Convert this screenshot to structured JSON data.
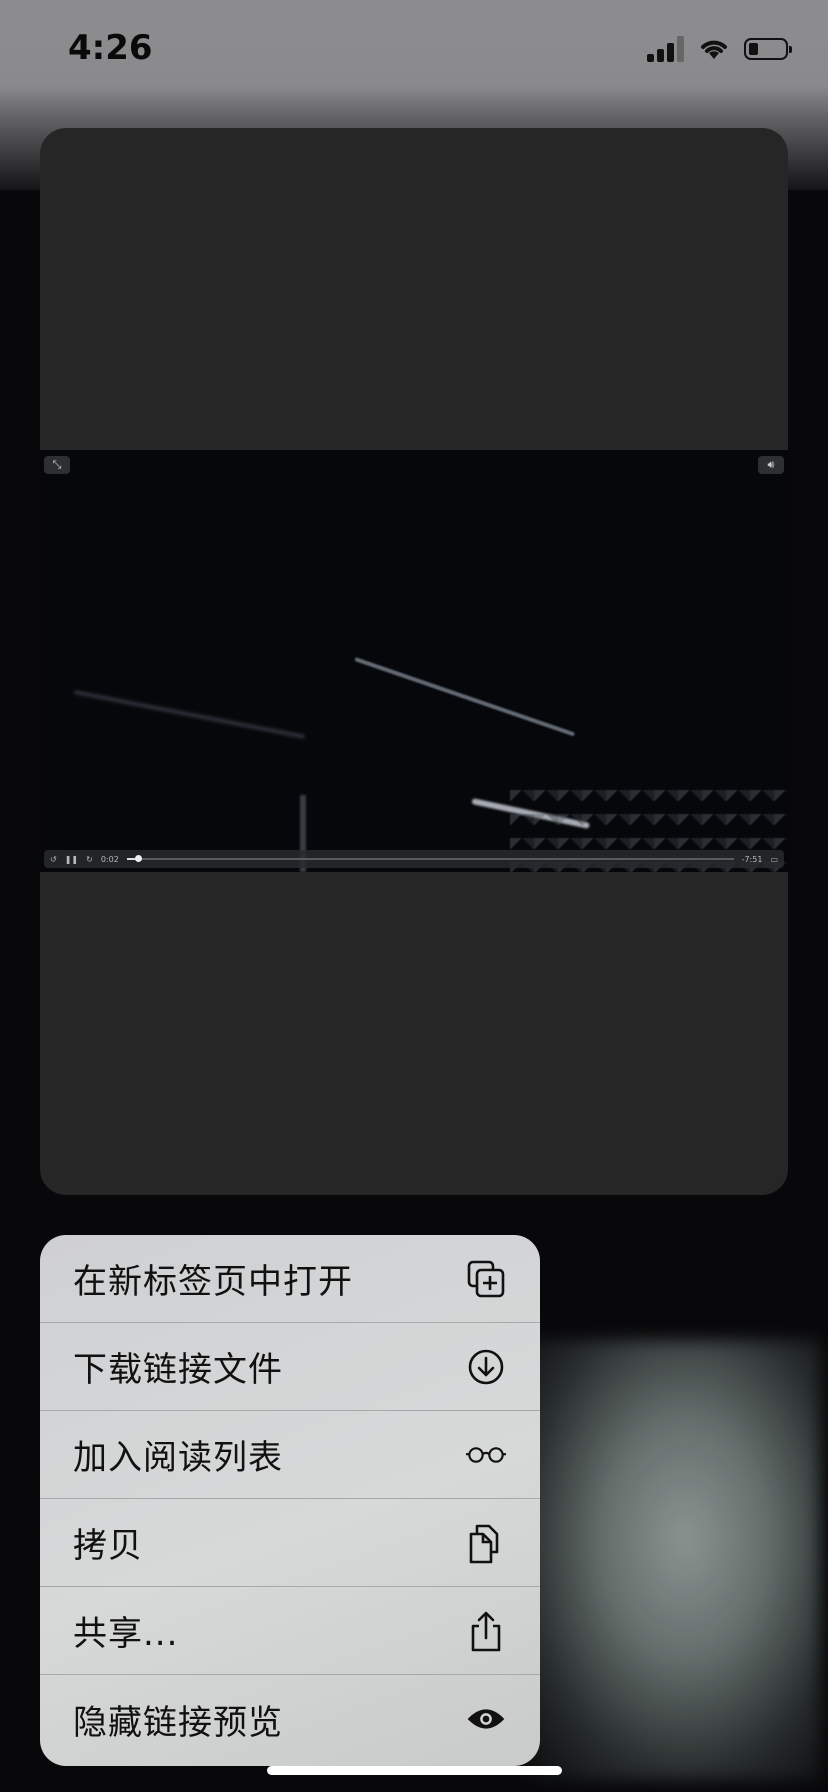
{
  "status": {
    "time": "4:26"
  },
  "video": {
    "elapsed": "0:02",
    "remaining": "-7:51",
    "progress": 0.018
  },
  "menu": {
    "items": [
      {
        "label": "在新标签页中打开",
        "icon": "new-tab-icon"
      },
      {
        "label": "下载链接文件",
        "icon": "download-icon"
      },
      {
        "label": "加入阅读列表",
        "icon": "glasses-icon"
      },
      {
        "label": "拷贝",
        "icon": "copy-icon"
      },
      {
        "label": "共享...",
        "icon": "share-icon"
      },
      {
        "label": "隐藏链接预览",
        "icon": "eye-icon"
      }
    ]
  }
}
